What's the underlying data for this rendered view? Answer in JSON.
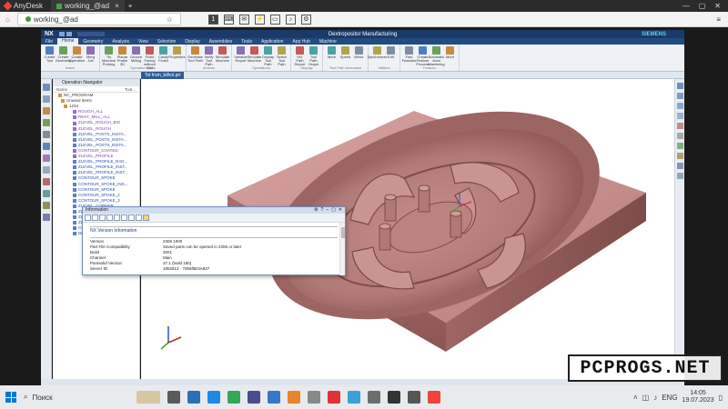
{
  "anydesk": {
    "app_name": "AnyDesk",
    "tab_label": "working_@ad"
  },
  "session": {
    "address": "working_@ad",
    "display_label": "1"
  },
  "nx": {
    "logo": "NX",
    "window_title": "Dextropositor Manufacturing",
    "vendor": "SIEMENS",
    "menu": [
      "File",
      "Home",
      "Geometry",
      "Analysis",
      "View",
      "Selection",
      "Display",
      "Assemblies",
      "Tools",
      "Application",
      "App Hub",
      "Machine"
    ],
    "active_menu": "Home",
    "file_tab": "Tst from_bilhol.prt",
    "ribbon_groups": [
      {
        "label": "Insert",
        "buttons": [
          "Create Tool",
          "Create Geometry",
          "Create Operation",
          "Merg Job"
        ]
      },
      {
        "label": "Operation Tools",
        "buttons": [
          "Tis Machine Probing",
          "Planar Profile 3D",
          "Groove Milling",
          "Fixed Facing without Wall",
          "Cavity Finish",
          "Properties"
        ]
      },
      {
        "label": "Actions",
        "buttons": [
          "Generate Tool Path",
          "Verify Tool Path",
          "Simulate Machine"
        ]
      },
      {
        "label": "Operations",
        "buttons": [
          "Variable Report",
          "Simulate Machine",
          "Display Tool Path",
          "Select Tool Path"
        ]
      },
      {
        "label": "Display",
        "buttons": [
          "Vel. Path Report",
          "Tool Path Graph"
        ]
      },
      {
        "label": "Tool Path Animation",
        "buttons": [
          "More",
          "Speed",
          "Mirror"
        ]
      },
      {
        "label": "Utilities",
        "buttons": [
          "Synchronize",
          "Edit"
        ]
      },
      {
        "label": "Feature",
        "buttons": [
          "Find Features",
          "Create Feature Process",
          "Automatic Area Machining",
          "More"
        ]
      }
    ]
  },
  "navigator": {
    "title": "Operation Navigator",
    "col_name": "Name",
    "col_toolpath": "Tool...",
    "rows": [
      {
        "text": "NC_PROGRAM",
        "tone": "normal"
      },
      {
        "text": "Unused Items",
        "tone": "normal"
      },
      {
        "text": "1234",
        "tone": "normal"
      },
      {
        "text": "ROUGH_ALL",
        "tone": "purple"
      },
      {
        "text": "REST_MILL_ALL",
        "tone": "purple"
      },
      {
        "text": "ZLEVEL_ROUGH_BIG",
        "tone": "purple"
      },
      {
        "text": "ZLEVEL_ROUGH",
        "tone": "purple"
      },
      {
        "text": "ZLEVEL_POSTS_INSTA...",
        "tone": "blue"
      },
      {
        "text": "ZLEVEL_POSTS_INSTA...",
        "tone": "blue"
      },
      {
        "text": "ZLEVEL_POSTS_INSTA...",
        "tone": "blue"
      },
      {
        "text": "CONTOUR_COATED",
        "tone": "purple"
      },
      {
        "text": "ZLEVEL_PROFILE",
        "tone": "purple"
      },
      {
        "text": "ZLEVEL_PROFILE_RAD...",
        "tone": "blue"
      },
      {
        "text": "ZLEVEL_PROFILE_INST...",
        "tone": "blue"
      },
      {
        "text": "ZLEVEL_PROFILE_INST...",
        "tone": "blue"
      },
      {
        "text": "CONTOUR_SPOKE",
        "tone": "blue"
      },
      {
        "text": "CONTOUR_SPOKE_INS...",
        "tone": "blue"
      },
      {
        "text": "CONTOUR_SPOKE",
        "tone": "blue"
      },
      {
        "text": "CONTOUR_SPOKE_2",
        "tone": "blue"
      },
      {
        "text": "CONTOUR_SPOKE_3",
        "tone": "blue"
      },
      {
        "text": "ZLEVEL_CORNER",
        "tone": "blue"
      },
      {
        "text": "ZLEVEL_CORNER_INS...",
        "tone": "blue"
      },
      {
        "text": "ZLEVEL_CORNER_INS...",
        "tone": "blue"
      },
      {
        "text": "ZLEVEL_CORNER_INS...",
        "tone": "blue"
      },
      {
        "text": "CONTOUR_HOLE",
        "tone": "blue"
      },
      {
        "text": "DRILL_MILL_HOLE",
        "tone": "blue"
      }
    ]
  },
  "info_dialog": {
    "title": "Information",
    "section": "NX Version Information",
    "rows": [
      {
        "label": "Version",
        "value": "2306 1000"
      },
      {
        "label": "Part File Compatibility",
        "value": "Saved parts can be opened in 2306 or later"
      },
      {
        "label": "Build",
        "value": "3001"
      },
      {
        "label": "Channel",
        "value": "Main"
      },
      {
        "label": "Parasolid Version",
        "value": "37.1 (build 180)"
      },
      {
        "label": "Server ID",
        "value": "1852813 - 70b6f5E3A827"
      }
    ]
  },
  "taskbar": {
    "search_label": "Поиск",
    "lang": "ENG",
    "time": "14:05",
    "date": "19.07.2023"
  },
  "watermark": "PCPROGS.NET",
  "colors": {
    "part_body": "#c9928f",
    "nx_title": "#1a3a6a",
    "nx_menu": "#244b80"
  }
}
